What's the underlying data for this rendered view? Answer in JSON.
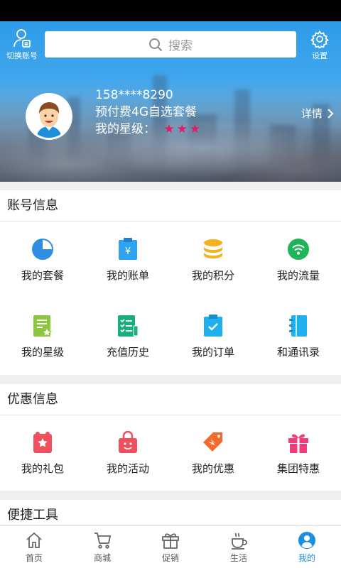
{
  "header": {
    "switch_account_label": "切换账号",
    "search_placeholder": "搜索",
    "settings_label": "设置"
  },
  "user": {
    "phone": "158****8290",
    "plan": "预付费4G自选套餐",
    "star_label": "我的星级：",
    "star_count": 3,
    "detail_label": "详情"
  },
  "sections": {
    "account": {
      "title": "账号信息",
      "items": [
        {
          "label": "我的套餐",
          "icon": "pie-chart-icon",
          "color": "#2d8fe4"
        },
        {
          "label": "我的账单",
          "icon": "bill-icon",
          "color": "#2ea3f2"
        },
        {
          "label": "我的积分",
          "icon": "coins-icon",
          "color": "#f4b21c"
        },
        {
          "label": "我的流量",
          "icon": "wifi-icon",
          "color": "#20b45a"
        },
        {
          "label": "我的星级",
          "icon": "star-doc-icon",
          "color": "#8cc63f"
        },
        {
          "label": "充值历史",
          "icon": "history-list-icon",
          "color": "#17b07a"
        },
        {
          "label": "我的订单",
          "icon": "order-check-icon",
          "color": "#1fb0ef"
        },
        {
          "label": "和通讯录",
          "icon": "contacts-book-icon",
          "color": "#1fb0ef"
        }
      ]
    },
    "promo": {
      "title": "优惠信息",
      "items": [
        {
          "label": "我的礼包",
          "icon": "gift-pack-icon",
          "color": "#f0505e"
        },
        {
          "label": "我的活动",
          "icon": "shopping-bag-icon",
          "color": "#f0505e"
        },
        {
          "label": "我的优惠",
          "icon": "coupon-tag-icon",
          "color": "#f26a2c"
        },
        {
          "label": "集团特惠",
          "icon": "gift-box-icon",
          "color": "#f03c7a"
        }
      ]
    },
    "tools": {
      "title": "便捷工具"
    }
  },
  "bottom_nav": [
    {
      "label": "首页",
      "icon": "home-icon",
      "active": false
    },
    {
      "label": "商城",
      "icon": "cart-icon",
      "active": false
    },
    {
      "label": "促销",
      "icon": "gift-icon",
      "active": false
    },
    {
      "label": "生活",
      "icon": "coffee-icon",
      "active": false
    },
    {
      "label": "我的",
      "icon": "user-circle-icon",
      "active": true
    }
  ],
  "colors": {
    "accent": "#1d8ee0",
    "star": "#e6186b"
  }
}
